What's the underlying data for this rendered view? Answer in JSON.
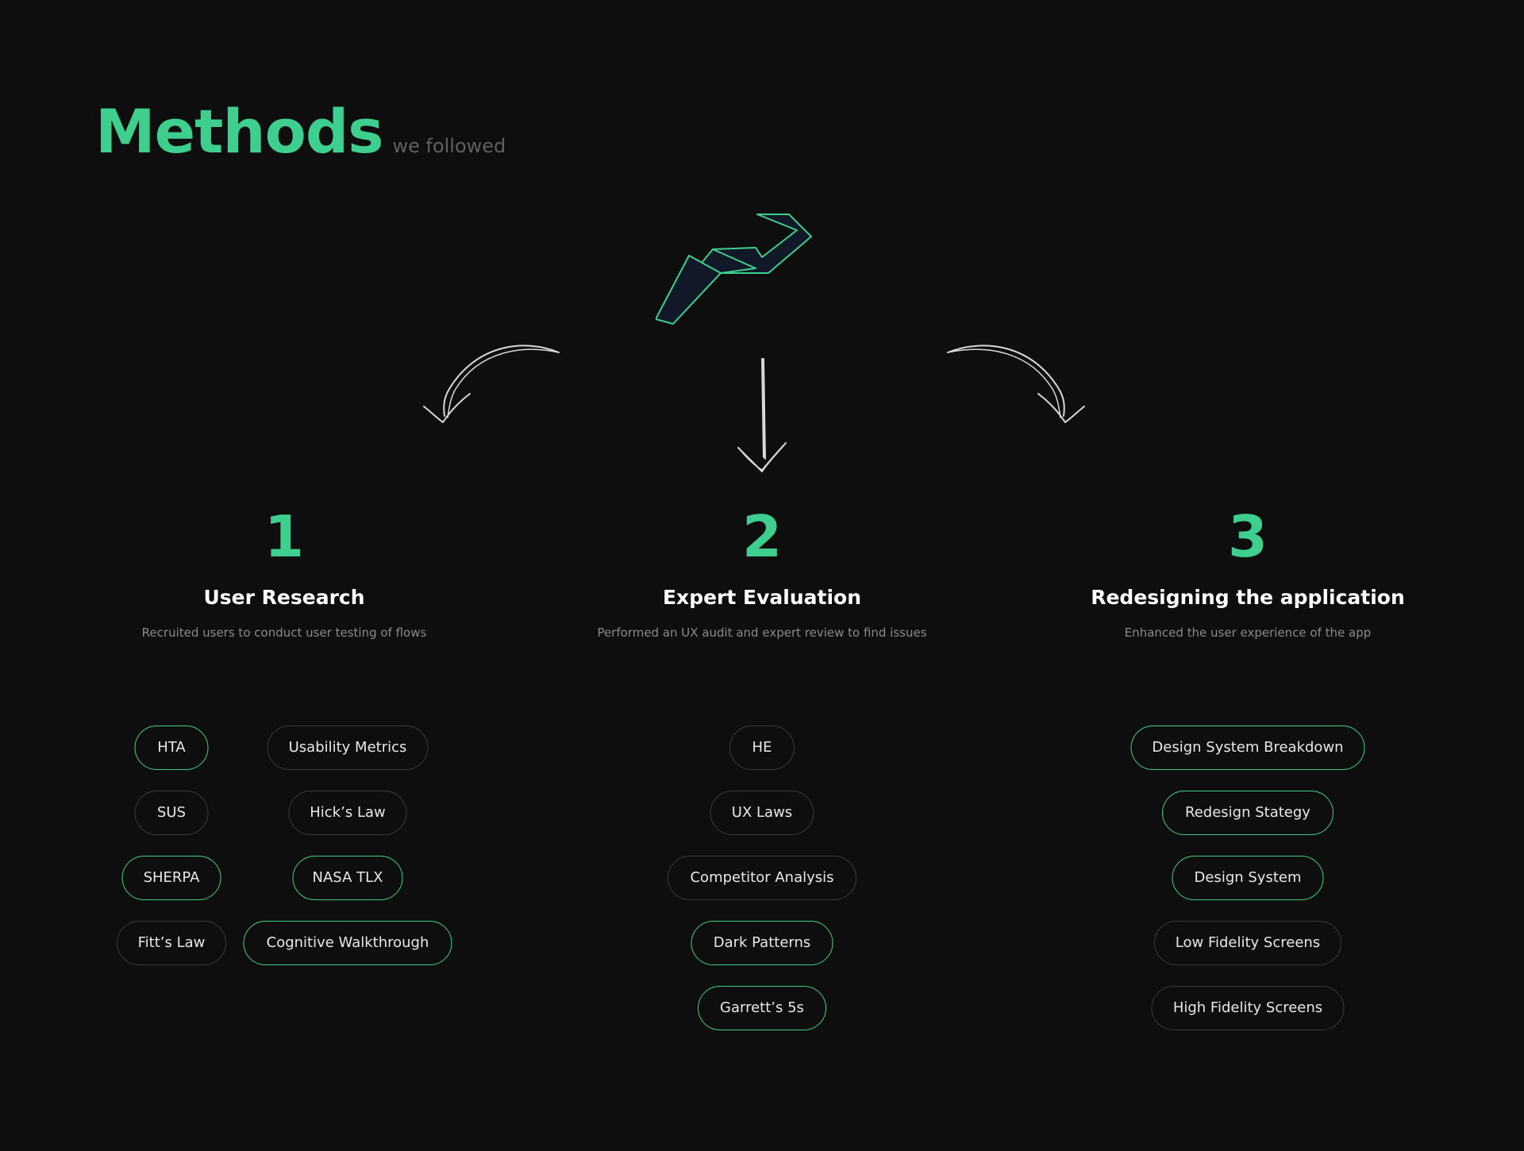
{
  "header": {
    "title": "Methods",
    "subtitle": "we followed"
  },
  "accent_color": "#3ecf8e",
  "logo_icon": "zigzag-arrow-logo",
  "columns": [
    {
      "number": "1",
      "title": "User Research",
      "description": "Recruited users to conduct user testing of flows",
      "tags": [
        {
          "label": "HTA",
          "highlighted": true
        },
        {
          "label": "Usability Metrics",
          "highlighted": false
        },
        {
          "label": "SUS",
          "highlighted": false
        },
        {
          "label": "Hick’s Law",
          "highlighted": false
        },
        {
          "label": "SHERPA",
          "highlighted": true
        },
        {
          "label": "NASA TLX",
          "highlighted": true
        },
        {
          "label": "Fitt’s Law",
          "highlighted": false
        },
        {
          "label": "Cognitive Walkthrough",
          "highlighted": true
        }
      ]
    },
    {
      "number": "2",
      "title": "Expert Evaluation",
      "description": "Performed an UX audit and expert review to find issues",
      "tags": [
        {
          "label": "HE",
          "highlighted": false
        },
        {
          "label": "UX Laws",
          "highlighted": false
        },
        {
          "label": "Competitor Analysis",
          "highlighted": false
        },
        {
          "label": "Dark Patterns",
          "highlighted": true
        },
        {
          "label": "Garrett’s 5s",
          "highlighted": true
        }
      ]
    },
    {
      "number": "3",
      "title": "Redesigning the application",
      "description": "Enhanced the user experience of the app",
      "tags": [
        {
          "label": "Design System Breakdown",
          "highlighted": true
        },
        {
          "label": "Redesign Stategy",
          "highlighted": true
        },
        {
          "label": "Design System",
          "highlighted": true
        },
        {
          "label": "Low Fidelity Screens",
          "highlighted": false
        },
        {
          "label": "High Fidelity Screens",
          "highlighted": false
        }
      ]
    }
  ]
}
